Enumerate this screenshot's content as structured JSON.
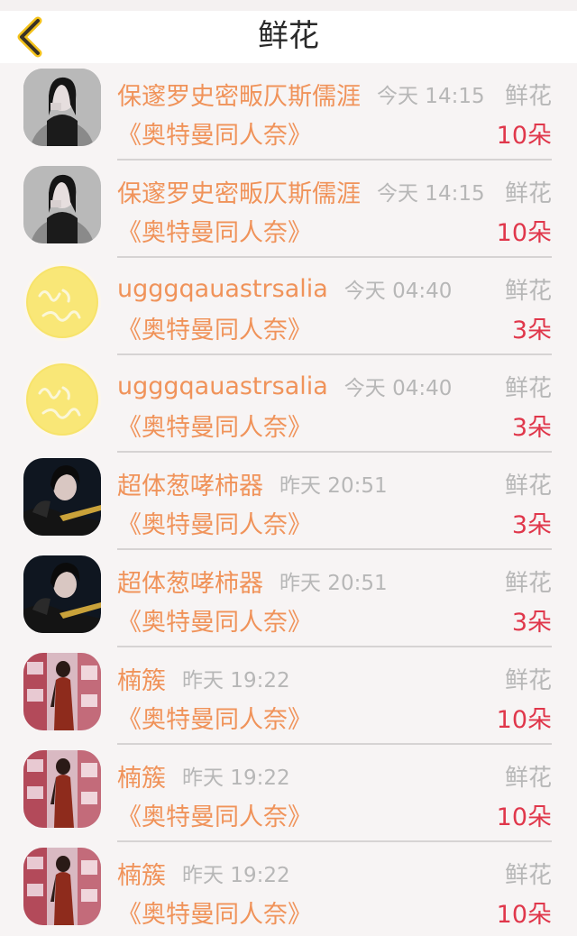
{
  "header": {
    "title": "鲜花",
    "back_icon": "chevron-left-icon",
    "accent_color": "#f4c21a"
  },
  "colors": {
    "name": "#f0935a",
    "time": "#b7b7b7",
    "amount": "#e0374b"
  },
  "records": [
    {
      "avatar": "avatar-photo-1",
      "name": "保邃罗史密畈仄斯儒涯",
      "time": "今天 14:15",
      "gift": "鲜花",
      "work": "《奥特曼同人奈》",
      "amount": "10朵"
    },
    {
      "avatar": "avatar-photo-1",
      "name": "保邃罗史密畈仄斯儒涯",
      "time": "今天 14:15",
      "gift": "鲜花",
      "work": "《奥特曼同人奈》",
      "amount": "10朵"
    },
    {
      "avatar": "avatar-yellow-circle",
      "name": "ugggqauastrsalia",
      "time": "今天 04:40",
      "gift": "鲜花",
      "work": "《奥特曼同人奈》",
      "amount": "3朵"
    },
    {
      "avatar": "avatar-yellow-circle",
      "name": "ugggqauastrsalia",
      "time": "今天 04:40",
      "gift": "鲜花",
      "work": "《奥特曼同人奈》",
      "amount": "3朵"
    },
    {
      "avatar": "avatar-photo-2",
      "name": "超体葱哮柿器",
      "time": "昨天 20:51",
      "gift": "鲜花",
      "work": "《奥特曼同人奈》",
      "amount": "3朵"
    },
    {
      "avatar": "avatar-photo-2",
      "name": "超体葱哮柿器",
      "time": "昨天 20:51",
      "gift": "鲜花",
      "work": "《奥特曼同人奈》",
      "amount": "3朵"
    },
    {
      "avatar": "avatar-photo-3",
      "name": "楠簇",
      "time": "昨天 19:22",
      "gift": "鲜花",
      "work": "《奥特曼同人奈》",
      "amount": "10朵"
    },
    {
      "avatar": "avatar-photo-3",
      "name": "楠簇",
      "time": "昨天 19:22",
      "gift": "鲜花",
      "work": "《奥特曼同人奈》",
      "amount": "10朵"
    },
    {
      "avatar": "avatar-photo-3",
      "name": "楠簇",
      "time": "昨天 19:22",
      "gift": "鲜花",
      "work": "《奥特曼同人奈》",
      "amount": "10朵"
    }
  ]
}
